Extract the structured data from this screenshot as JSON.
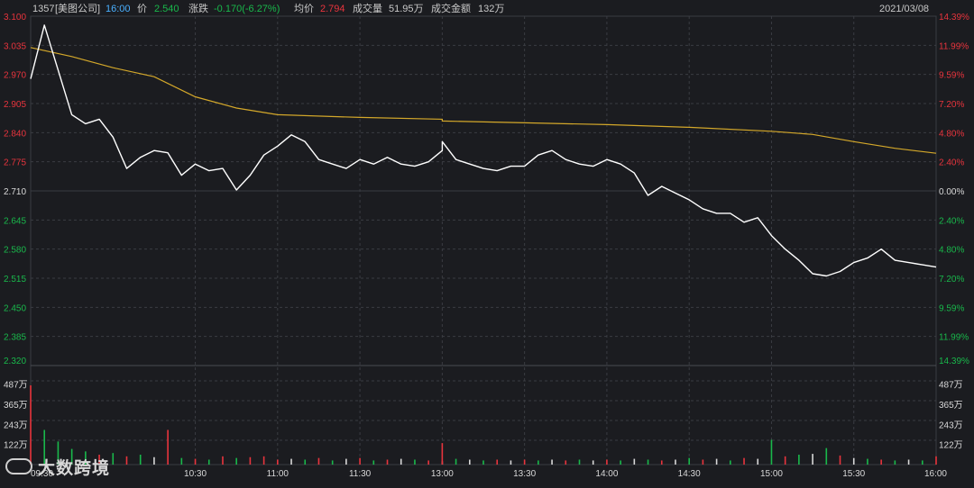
{
  "header": {
    "code": "1357",
    "name": "[美图公司]",
    "time": "16:00",
    "price_label": "价",
    "price": "2.540",
    "change_label": "涨跌",
    "change": "-0.170(-6.27%)",
    "avg_label": "均价",
    "avg": "2.794",
    "volume_label": "成交量",
    "volume": "51.95万",
    "amount_label": "成交金额",
    "amount": "132万",
    "date": "2021/03/08"
  },
  "colors": {
    "background": "#1b1c20",
    "up": "#e8343d",
    "down": "#19b84b",
    "flat": "#d8d8d8",
    "price_line": "#ffffff",
    "avg_line": "#d4a82a",
    "grid": "#3a3c42",
    "header_blue": "#4ab0ff"
  },
  "watermark": "大数跨境",
  "chart_data": [
    {
      "type": "line",
      "title": "",
      "xlabel": "",
      "ylabel": "",
      "ylim": [
        2.32,
        3.1
      ],
      "y_ticks_left": [
        "3.100",
        "3.035",
        "2.970",
        "2.905",
        "2.840",
        "2.775",
        "2.710",
        "2.645",
        "2.580",
        "2.515",
        "2.450",
        "2.385",
        "2.320"
      ],
      "y_ticks_right": [
        "14.39%",
        "11.99%",
        "9.59%",
        "7.20%",
        "4.80%",
        "2.40%",
        "0.00%",
        "2.40%",
        "4.80%",
        "7.20%",
        "9.59%",
        "11.99%",
        "14.39%"
      ],
      "prev_close": 2.71,
      "x_ticks": [
        "09:30",
        "10:30",
        "11:00",
        "11:30",
        "13:00",
        "13:30",
        "14:00",
        "14:30",
        "15:00",
        "15:30",
        "16:00"
      ],
      "series": [
        {
          "name": "价",
          "x": [
            "09:30",
            "09:35",
            "09:40",
            "09:45",
            "09:50",
            "09:55",
            "10:00",
            "10:05",
            "10:10",
            "10:15",
            "10:20",
            "10:25",
            "10:30",
            "10:35",
            "10:40",
            "10:45",
            "10:50",
            "10:55",
            "11:00",
            "11:05",
            "11:10",
            "11:15",
            "11:20",
            "11:25",
            "11:30",
            "11:35",
            "11:40",
            "11:45",
            "11:50",
            "11:55",
            "12:00",
            "13:00",
            "13:05",
            "13:10",
            "13:15",
            "13:20",
            "13:25",
            "13:30",
            "13:35",
            "13:40",
            "13:45",
            "13:50",
            "13:55",
            "14:00",
            "14:05",
            "14:10",
            "14:15",
            "14:20",
            "14:25",
            "14:30",
            "14:35",
            "14:40",
            "14:45",
            "14:50",
            "14:55",
            "15:00",
            "15:05",
            "15:10",
            "15:15",
            "15:20",
            "15:25",
            "15:30",
            "15:35",
            "15:40",
            "15:45",
            "15:50",
            "15:55",
            "16:00"
          ],
          "values": [
            2.96,
            3.08,
            2.98,
            2.88,
            2.86,
            2.87,
            2.83,
            2.76,
            2.785,
            2.8,
            2.795,
            2.745,
            2.77,
            2.755,
            2.76,
            2.712,
            2.745,
            2.79,
            2.81,
            2.835,
            2.82,
            2.78,
            2.77,
            2.76,
            2.78,
            2.77,
            2.785,
            2.77,
            2.765,
            2.775,
            2.8,
            2.82,
            2.78,
            2.77,
            2.76,
            2.755,
            2.765,
            2.765,
            2.79,
            2.8,
            2.78,
            2.77,
            2.765,
            2.78,
            2.77,
            2.75,
            2.7,
            2.72,
            2.705,
            2.69,
            2.67,
            2.66,
            2.66,
            2.64,
            2.65,
            2.61,
            2.58,
            2.555,
            2.525,
            2.52,
            2.53,
            2.55,
            2.56,
            2.58,
            2.555,
            2.55,
            2.545,
            2.54
          ]
        },
        {
          "name": "均价",
          "x": [
            "09:30",
            "09:45",
            "10:00",
            "10:15",
            "10:30",
            "10:45",
            "11:00",
            "11:30",
            "12:00",
            "13:00",
            "13:30",
            "14:00",
            "14:30",
            "15:00",
            "15:15",
            "15:30",
            "15:45",
            "16:00"
          ],
          "values": [
            3.03,
            3.01,
            2.985,
            2.965,
            2.92,
            2.895,
            2.88,
            2.874,
            2.87,
            2.866,
            2.862,
            2.858,
            2.852,
            2.843,
            2.836,
            2.82,
            2.805,
            2.794
          ]
        }
      ]
    },
    {
      "type": "bar",
      "title": "",
      "y_ticks": [
        "487万",
        "365万",
        "243万",
        "122万"
      ],
      "ylim": [
        0,
        600
      ],
      "unit": "万股",
      "categories": [
        "09:30",
        "09:35",
        "09:40",
        "09:45",
        "09:50",
        "09:55",
        "10:00",
        "10:05",
        "10:10",
        "10:15",
        "10:20",
        "10:25",
        "10:30",
        "10:35",
        "10:40",
        "10:45",
        "10:50",
        "10:55",
        "11:00",
        "11:05",
        "11:10",
        "11:15",
        "11:20",
        "11:25",
        "11:30",
        "11:35",
        "11:40",
        "11:45",
        "11:50",
        "11:55",
        "12:00",
        "13:00",
        "13:05",
        "13:10",
        "13:15",
        "13:20",
        "13:25",
        "13:30",
        "13:35",
        "13:40",
        "13:45",
        "13:50",
        "13:55",
        "14:00",
        "14:05",
        "14:10",
        "14:15",
        "14:20",
        "14:25",
        "14:30",
        "14:35",
        "14:40",
        "14:45",
        "14:50",
        "14:55",
        "15:00",
        "15:05",
        "15:10",
        "15:15",
        "15:20",
        "15:25",
        "15:30",
        "15:35",
        "15:40",
        "15:45",
        "15:50",
        "15:55",
        "16:00"
      ],
      "values": [
        480,
        210,
        140,
        95,
        80,
        60,
        70,
        50,
        60,
        45,
        210,
        40,
        35,
        30,
        50,
        40,
        45,
        50,
        30,
        35,
        30,
        40,
        25,
        35,
        40,
        25,
        30,
        35,
        30,
        25,
        20,
        130,
        35,
        30,
        25,
        30,
        25,
        30,
        25,
        30,
        25,
        30,
        25,
        30,
        25,
        35,
        30,
        25,
        30,
        40,
        30,
        35,
        25,
        40,
        35,
        150,
        50,
        60,
        65,
        100,
        55,
        40,
        35,
        30,
        25,
        30,
        25,
        50
      ],
      "direction": [
        "up",
        "down",
        "down",
        "down",
        "down",
        "up",
        "down",
        "up",
        "down",
        "flat",
        "up",
        "down",
        "up",
        "down",
        "up",
        "down",
        "up",
        "up",
        "up",
        "flat",
        "down",
        "up",
        "down",
        "flat",
        "up",
        "down",
        "up",
        "flat",
        "down",
        "up",
        "flat",
        "up",
        "down",
        "flat",
        "down",
        "up",
        "flat",
        "up",
        "down",
        "flat",
        "up",
        "down",
        "flat",
        "up",
        "down",
        "flat",
        "down",
        "up",
        "flat",
        "down",
        "up",
        "flat",
        "down",
        "up",
        "flat",
        "down",
        "up",
        "down",
        "flat",
        "down",
        "up",
        "flat",
        "down",
        "up",
        "down",
        "flat",
        "down",
        "up"
      ]
    }
  ]
}
